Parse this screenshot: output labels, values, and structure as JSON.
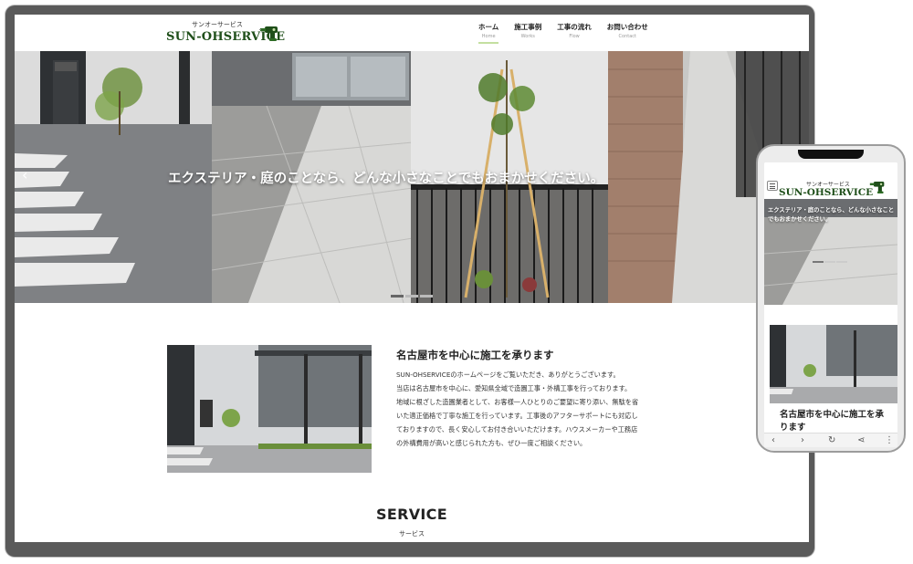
{
  "site": {
    "logo_small": "サンオーサービス",
    "logo_main": "SUN-OHSERVICE"
  },
  "nav": {
    "items": [
      {
        "label": "ホーム",
        "sub": "Home"
      },
      {
        "label": "施工事例",
        "sub": "Works"
      },
      {
        "label": "工事の流れ",
        "sub": "Flow"
      },
      {
        "label": "お問い合わせ",
        "sub": "Contact"
      }
    ],
    "active_index": 0
  },
  "hero": {
    "caption": "エクステリア・庭のことなら、どんな小さなことでもおまかせください。",
    "prev_arrow": "‹",
    "slide_total": 3,
    "slide_active": 1
  },
  "about": {
    "title": "名古屋市を中心に施工を承ります",
    "paragraphs": [
      "SUN-OHSERVICEのホームページをご覧いただき、ありがとうございます。",
      "当店は名古屋市を中心に、愛知県全域で造園工事・外構工事を行っております。",
      "地域に根ざした造園業者として、お客様一人ひとりのご要望に寄り添い、無駄を省いた適正価格で丁寧な施工を行っています。工事後のアフターサポートにも対応しておりますので、長く安心してお付き合いいただけます。ハウスメーカーや工務店の外構費用が高いと感じられた方も、ぜひ一度ご相談ください。"
    ]
  },
  "service": {
    "title": "SERVICE",
    "sub": "サービス"
  },
  "phone": {
    "caption": "エクステリア・庭のことなら、どんな小さなことでもおまかせください。",
    "title": "名古屋市を中心に施工を承ります",
    "bar": {
      "back": "‹",
      "forward": "›",
      "reload": "↻",
      "share": "⋖",
      "more": "⋮"
    }
  },
  "colors": {
    "logo_green": "#1f4f1a",
    "device_frame": "#5a5a5a",
    "nav_underline": "#c4dfa0"
  },
  "icons": [
    "drill-icon",
    "chevron-left-icon",
    "hamburger-menu-icon",
    "reload-icon",
    "share-icon",
    "more-icon"
  ]
}
